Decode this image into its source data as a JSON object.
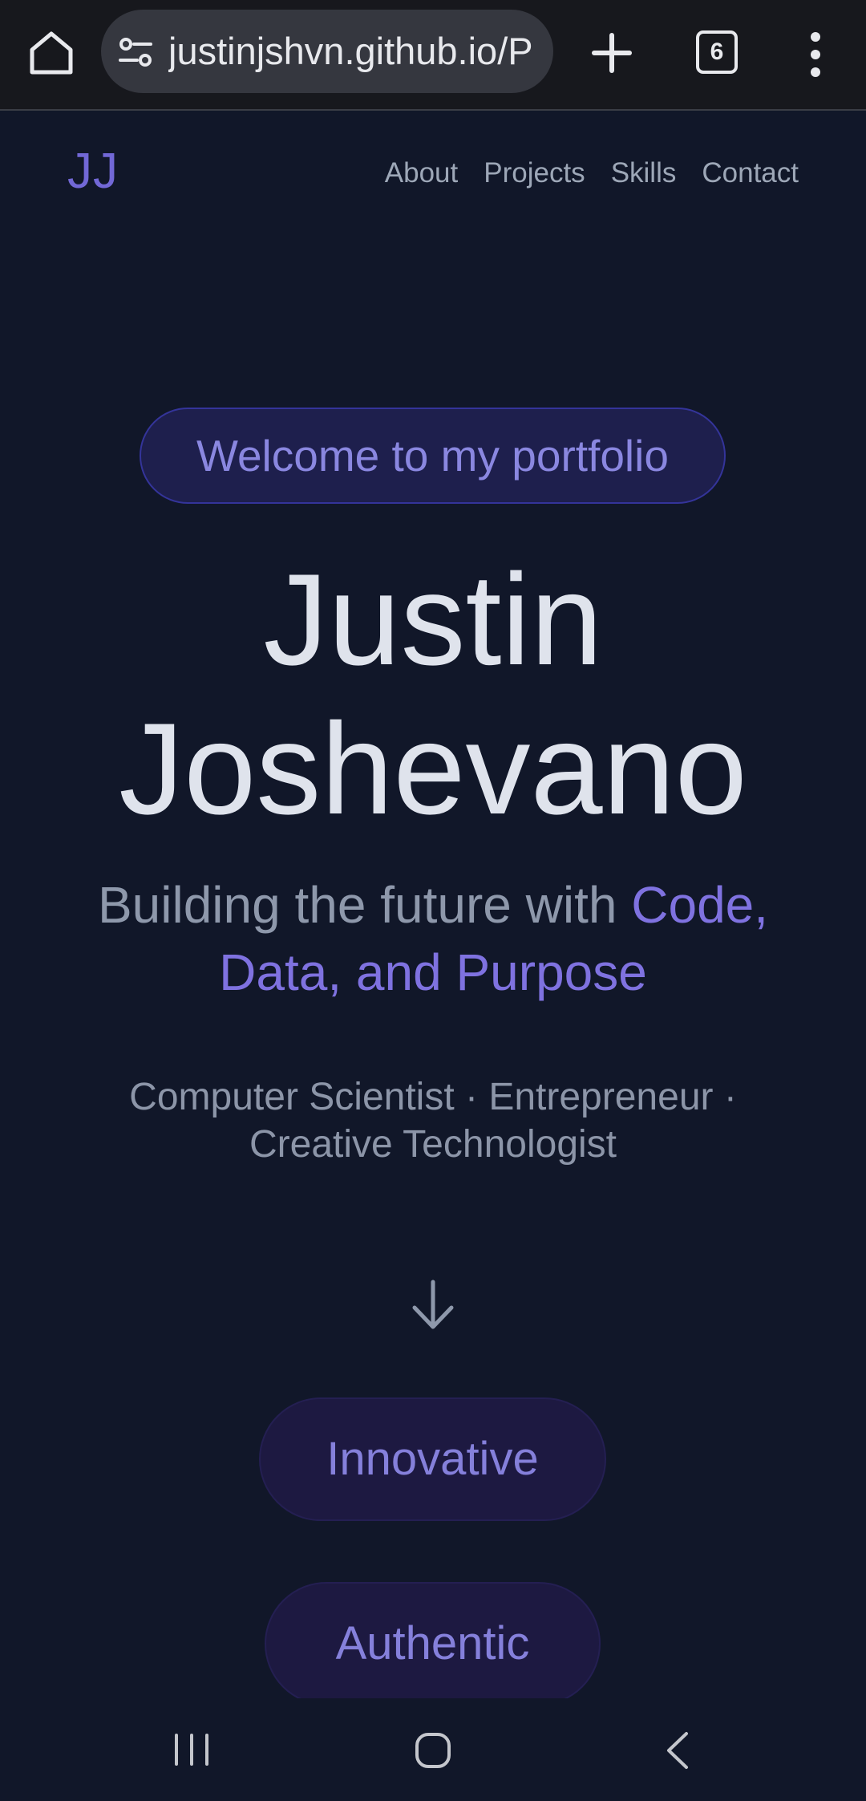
{
  "browser": {
    "url": "justinjshvn.github.io/P",
    "tab_count": "6",
    "icons": [
      "home-icon",
      "site-settings-icon",
      "new-tab-plus-icon",
      "tab-switcher-icon",
      "overflow-menu-icon"
    ]
  },
  "site": {
    "logo": "JJ",
    "nav": [
      "About",
      "Projects",
      "Skills",
      "Contact"
    ]
  },
  "hero": {
    "badge": "Welcome to my portfolio",
    "name_line1": "Justin",
    "name_line2": "Joshevano",
    "tagline_prefix": "Building the future with ",
    "tagline_accent": "Code, Data, and Purpose",
    "roles_line1": "Computer Scientist · Entrepreneur ·",
    "roles_line2": "Creative Technologist",
    "scroll_icon": "arrow-down-icon"
  },
  "chips": [
    "Innovative",
    "Authentic"
  ],
  "system_nav": [
    "recents-icon",
    "home-icon",
    "back-icon"
  ],
  "colors": {
    "background": "#111729",
    "accent": "#7f72e0",
    "heading": "#dfe3ec",
    "muted": "#8e98ab"
  }
}
